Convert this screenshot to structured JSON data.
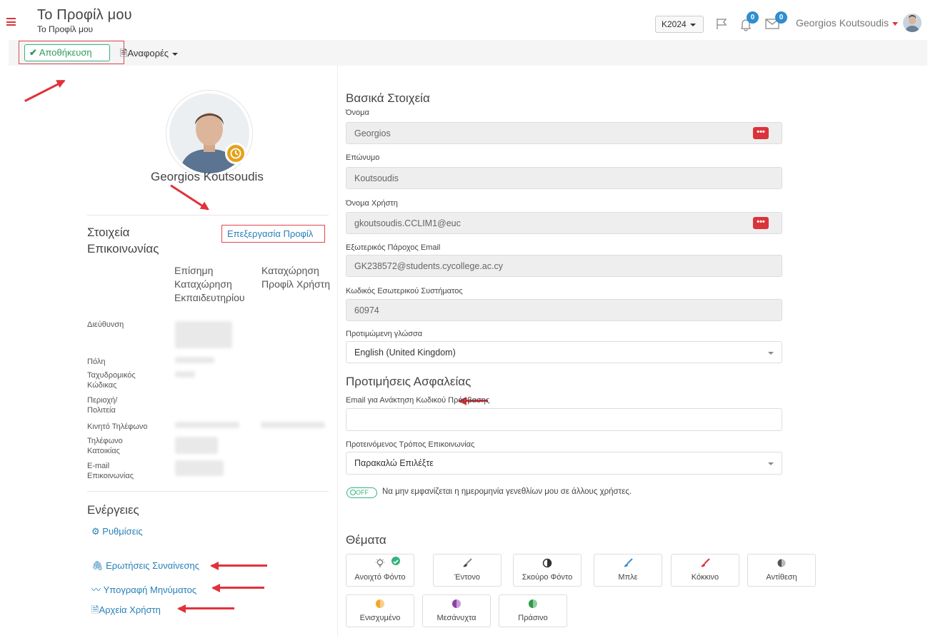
{
  "header": {
    "title": "Το Προφίλ μου",
    "subtitle": "Το Προφίλ μου",
    "year_select": "K2024",
    "notifications_count": "0",
    "messages_count": "0",
    "user_name": "Georgios Koutsoudis"
  },
  "toolbar": {
    "save_label": "Αποθήκευση",
    "reports_label": "Αναφορές"
  },
  "profile": {
    "name": "Georgios Koutsoudis"
  },
  "contact": {
    "title": "Στοιχεία Επικοινωνίας",
    "edit_link": "Επεξεργασία Προφίλ",
    "col_official": "Επίσημη Καταχώρηση Εκπαιδευτηρίου",
    "col_user": "Καταχώρηση Προφίλ Χρήστη",
    "rows": [
      "Διεύθυνση",
      "Πόλη",
      "Ταχυδρομικός Κώδικας",
      "Περιοχή/ Πολιτεία",
      "Κινητό Τηλέφωνο",
      "Τηλέφωνο Κατοικίας",
      "E-mail Επικοινωνίας"
    ]
  },
  "actions": {
    "title": "Ενέργειες",
    "settings": "Ρυθμίσεις",
    "comprehension": "Ερωτήσεις Συναίνεσης",
    "signature": "Υπογραφή Μηνύματος",
    "files": "Αρχεία Χρήστη"
  },
  "basic": {
    "title": "Βασικά Στοιχεία",
    "first_name_label": "Όνομα",
    "first_name": "Georgios",
    "last_name_label": "Επώνυμο",
    "last_name": "Koutsoudis",
    "username_label": "Όνομα Χρήστη",
    "username": "gkoutsoudis.CCLIM1@euc",
    "ext_email_label": "Εξωτερικός Πάροχος Email",
    "ext_email": "GK238572@students.cycollege.ac.cy",
    "internal_code_label": "Κωδικός Εσωτερικού Συστήματος",
    "internal_code": "60974",
    "language_label": "Προτιμώμενη γλώσσα",
    "language": "English (United Kingdom)"
  },
  "security": {
    "title": "Προτιμήσεις Ασφαλείας",
    "recovery_email_label": "Email για Ανάκτηση Κωδικού Πρόσβασης",
    "recovery_email_placeholder": "",
    "contact_method_label": "Προτεινόμενος Τρόπος Επικοινωνίας",
    "contact_method": "Παρακαλώ Επιλέξτε",
    "toggle_state": "OFF",
    "toggle_text": "Να μην εμφανίζεται η ημερομηνία γενεθλίων μου σε άλλους χρήστες."
  },
  "themes": {
    "title": "Θέματα",
    "items": [
      {
        "label": "Ανοιχτό Φόντο",
        "color": "#f5c518"
      },
      {
        "label": "Έντονο",
        "color": "#555555"
      },
      {
        "label": "Σκούρο Φόντο",
        "color": "#333333"
      },
      {
        "label": "Μπλε",
        "color": "#3d8fd6"
      },
      {
        "label": "Κόκκινο",
        "color": "#d9343b"
      },
      {
        "label": "Αντίθεση",
        "color": "#555555"
      },
      {
        "label": "Ενισχυμένο",
        "color": "#f5a623"
      },
      {
        "label": "Μεσάνυχτα",
        "color": "#8e3fa8"
      },
      {
        "label": "Πράσινο",
        "color": "#2e9b45"
      }
    ]
  },
  "colors": {
    "accent": "#2780b8",
    "danger": "#d9343b",
    "success": "#36b37e"
  }
}
